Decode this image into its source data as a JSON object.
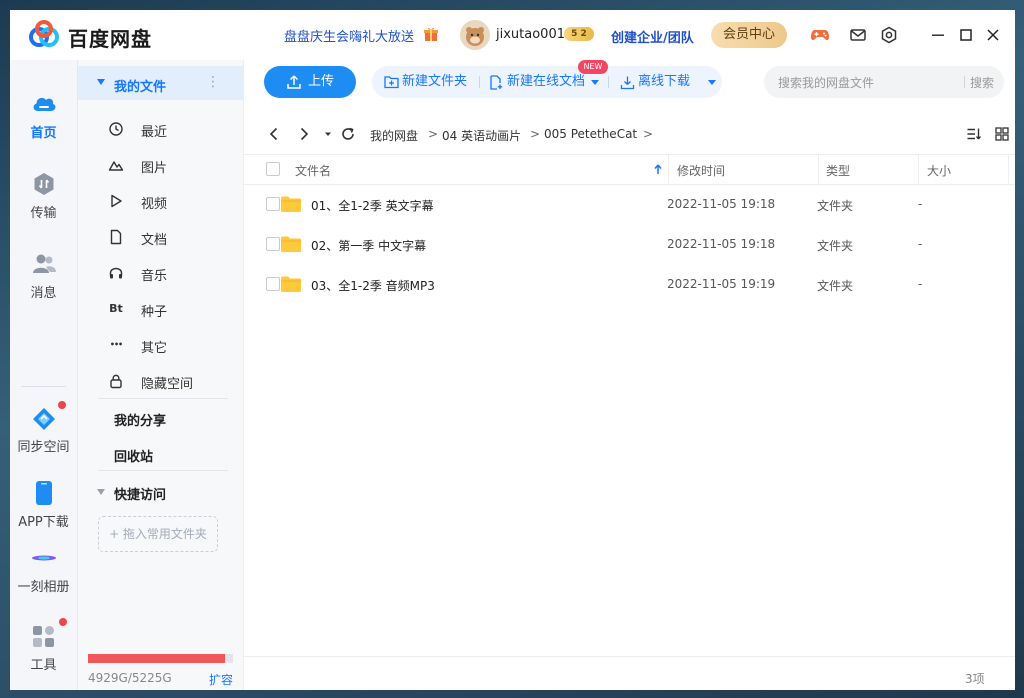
{
  "app": {
    "title": "百度网盘",
    "promo": "盘盘庆生会嗨礼大放送",
    "username": "jixutao001",
    "badge": "5 2",
    "enterprise": "创建企业/团队",
    "vip": "会员中心"
  },
  "leftnav": {
    "items": [
      {
        "label": "首页"
      },
      {
        "label": "传输"
      },
      {
        "label": "消息"
      },
      {
        "label": "同步空间"
      },
      {
        "label": "APP下载"
      },
      {
        "label": "一刻相册"
      },
      {
        "label": "工具"
      }
    ]
  },
  "sidebar": {
    "my_files": "我的文件",
    "items": [
      {
        "label": "最近",
        "icon": "clock-icon"
      },
      {
        "label": "图片",
        "icon": "image-icon"
      },
      {
        "label": "视频",
        "icon": "play-icon"
      },
      {
        "label": "文档",
        "icon": "document-icon"
      },
      {
        "label": "音乐",
        "icon": "headphones-icon"
      },
      {
        "label": "种子",
        "icon": "bt-icon",
        "glyph": "Bt"
      },
      {
        "label": "其它",
        "icon": "more-icon",
        "glyph": "•••"
      },
      {
        "label": "隐藏空间",
        "icon": "lock-icon"
      }
    ],
    "my_share": "我的分享",
    "recycle": "回收站",
    "quick_access": "快捷访问",
    "drop_hint": "+ 拖入常用文件夹",
    "quota_text": "4929G/5225G",
    "quota_used_fraction": 0.943,
    "expand": "扩容"
  },
  "toolbar": {
    "upload": "上传",
    "new_folder": "新建文件夹",
    "new_doc": "新建在线文档",
    "new_tag": "NEW",
    "offline": "离线下载",
    "search_placeholder": "搜索我的网盘文件",
    "search_btn": "搜索"
  },
  "breadcrumb": [
    "我的网盘",
    "04 英语动画片",
    "005 PetetheCat"
  ],
  "table": {
    "headers": [
      "文件名",
      "修改时间",
      "类型",
      "大小"
    ],
    "rows": [
      {
        "name": "01、全1-2季 英文字幕",
        "mtime": "2022-11-05 19:18",
        "type": "文件夹",
        "size": "-"
      },
      {
        "name": "02、第一季 中文字幕",
        "mtime": "2022-11-05 19:18",
        "type": "文件夹",
        "size": "-"
      },
      {
        "name": "03、全1-2季 音频MP3",
        "mtime": "2022-11-05 19:19",
        "type": "文件夹",
        "size": "-"
      }
    ]
  },
  "footer": {
    "count": "3项"
  },
  "colors": {
    "accent": "#1677ff",
    "upload": "#1e8df3",
    "quota": "#f0575b",
    "folder": "#ffc93c",
    "promo": "#1f4fc8"
  }
}
